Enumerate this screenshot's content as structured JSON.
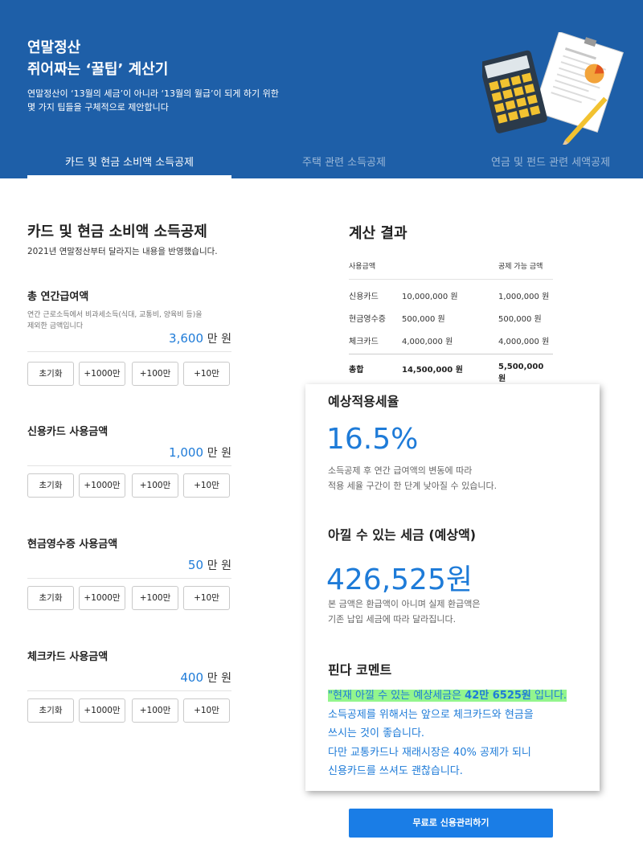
{
  "header": {
    "title_line1": "연말정산",
    "title_line2": "쥐어짜는 ‘꿀팁’ 계산기",
    "subtitle_line1": "연말정산이 ‘13월의 세금’이 아니라 ‘13월의 월급’이 되게 하기 위한",
    "subtitle_line2": "몇 가지 팁들을 구체적으로 제안합니다"
  },
  "tabs": [
    {
      "label": "카드 및 현금 소비액 소득공제",
      "active": true
    },
    {
      "label": "주택 관련 소득공제",
      "active": false
    },
    {
      "label": "연금 및 펀드 관련 세액공제",
      "active": false
    }
  ],
  "left": {
    "title": "카드 및 현금 소비액 소득공제",
    "subtitle": "2021년 연말정산부터 달라지는 내용을 반영했습니다.",
    "unit": "만 원",
    "buttons": {
      "reset": "초기화",
      "plus1000": "+1000만",
      "plus100": "+100만",
      "plus10": "+10만"
    },
    "fields": [
      {
        "label": "총 연간급여액",
        "desc_line1": "연간 근로소득에서 비과세소득(식대, 교통비, 양육비 등)을",
        "desc_line2": "제외한 금액입니다",
        "value": "3,600"
      },
      {
        "label": "신용카드 사용금액",
        "value": "1,000"
      },
      {
        "label": "현금영수증 사용금액",
        "value": "50"
      },
      {
        "label": "체크카드 사용금액",
        "value": "400"
      }
    ]
  },
  "result": {
    "title": "계산 결과",
    "head": {
      "c1": "사용금액",
      "c3": "공제 가능 금액"
    },
    "rows": [
      {
        "name": "신용카드",
        "used": "10,000,000 원",
        "deductible": "1,000,000 원"
      },
      {
        "name": "현금영수증",
        "used": "500,000 원",
        "deductible": "500,000 원"
      },
      {
        "name": "체크카드",
        "used": "4,000,000 원",
        "deductible": "4,000,000 원"
      }
    ],
    "total": {
      "name": "총합",
      "used": "14,500,000 원",
      "deductible": "5,500,000 원"
    }
  },
  "card": {
    "rate_title": "예상적용세율",
    "rate_value": "16.5%",
    "rate_desc_line1": "소득공제 후 연간 급여액의 변동에 따라",
    "rate_desc_line2": "적용 세율 구간이 한 단계 낮아질 수 있습니다.",
    "save_title": "아낄 수 있는 세금 (예상액)",
    "save_value": "426,525원",
    "save_desc_line1": "본 금액은 환급액이 아니며 실제 환급액은",
    "save_desc_line2": "기존 납입 세금에 따라 달라집니다.",
    "comment_title": "핀다 코멘트",
    "comment_hl_pre": "\"현재 아낄 수 있는 예상세금은 ",
    "comment_hl_bold": "42만 6525원",
    "comment_hl_post": " 입니다.",
    "comment_line2": "소득공제를 위해서는 앞으로 체크카드와 현금을",
    "comment_line3": "쓰시는 것이 좋습니다.",
    "comment_line4": "다만 교통카드나 재래시장은 40% 공제가 되니",
    "comment_line5": "신용카드를 쓰셔도 괜찮습니다."
  },
  "cta": {
    "label": "무료로 신용관리하기"
  },
  "colors": {
    "header_bg": "#1e5fa8",
    "accent": "#1e7bd8",
    "cta": "#1a7de6",
    "highlight": "#93f58d"
  }
}
